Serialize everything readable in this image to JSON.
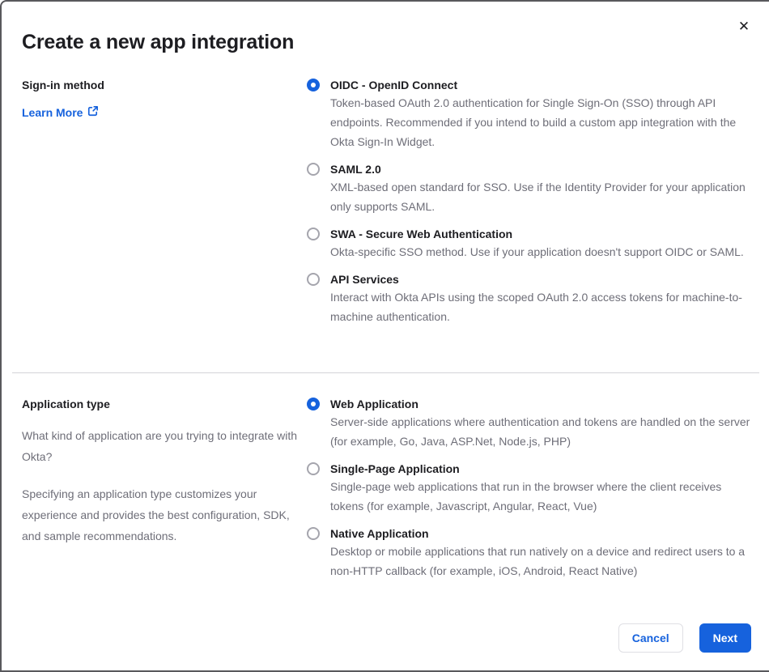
{
  "dialog": {
    "title": "Create a new app integration",
    "close_glyph": "✕"
  },
  "colors": {
    "accent": "#1662dd",
    "text": "#1d1d21",
    "muted_text": "#6e6e78",
    "divider": "#d3d3d8",
    "window_border": "#58585c"
  },
  "sections": [
    {
      "heading": "Sign-in method",
      "link_label": "Learn More",
      "options": [
        {
          "label": "OIDC - OpenID Connect",
          "description": "Token-based OAuth 2.0 authentication for Single Sign-On (SSO) through API endpoints. Recommended if you intend to build a custom app integration with the Okta Sign-In Widget.",
          "selected": true
        },
        {
          "label": "SAML 2.0",
          "description": "XML-based open standard for SSO. Use if the Identity Provider for your application only supports SAML.",
          "selected": false
        },
        {
          "label": "SWA - Secure Web Authentication",
          "description": "Okta-specific SSO method. Use if your application doesn't support OIDC or SAML.",
          "selected": false
        },
        {
          "label": "API Services",
          "description": "Interact with Okta APIs using the scoped OAuth 2.0 access tokens for machine-to-machine authentication.",
          "selected": false
        }
      ]
    },
    {
      "heading": "Application type",
      "paragraphs": [
        "What kind of application are you trying to integrate with Okta?",
        "Specifying an application type customizes your experience and provides the best configuration, SDK, and sample recommendations."
      ],
      "options": [
        {
          "label": "Web Application",
          "description": "Server-side applications where authentication and tokens are handled on the server (for example, Go, Java, ASP.Net, Node.js, PHP)",
          "selected": true
        },
        {
          "label": "Single-Page Application",
          "description": "Single-page web applications that run in the browser where the client receives tokens (for example, Javascript, Angular, React, Vue)",
          "selected": false
        },
        {
          "label": "Native Application",
          "description": "Desktop or mobile applications that run natively on a device and redirect users to a non-HTTP callback (for example, iOS, Android, React Native)",
          "selected": false
        }
      ]
    }
  ],
  "footer": {
    "cancel_label": "Cancel",
    "next_label": "Next"
  }
}
